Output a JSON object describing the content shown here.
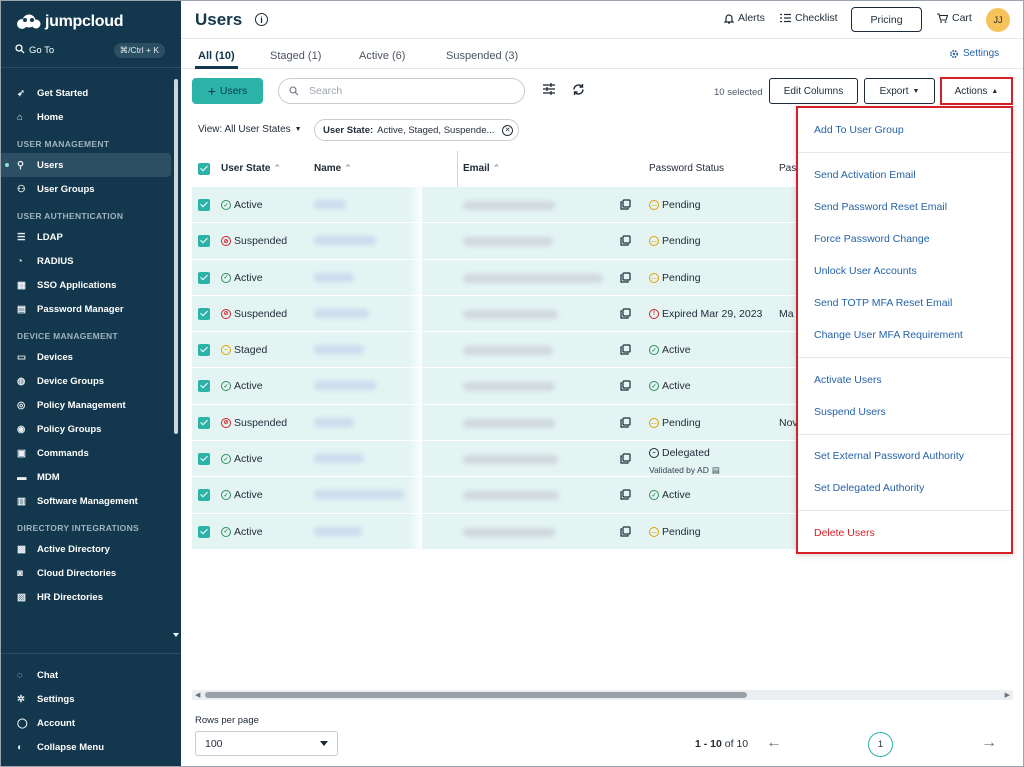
{
  "brand": {
    "name": "jumpcloud"
  },
  "sidebar": {
    "goto": {
      "label": "Go To",
      "shortcut": "⌘/Ctrl + K"
    },
    "items": [
      {
        "type": "item",
        "label": "Get Started",
        "icon": "rocket-icon"
      },
      {
        "type": "item",
        "label": "Home",
        "icon": "home-icon"
      },
      {
        "type": "section",
        "label": "USER MANAGEMENT"
      },
      {
        "type": "item",
        "label": "Users",
        "icon": "user-icon",
        "active": true
      },
      {
        "type": "item",
        "label": "User Groups",
        "icon": "users-icon"
      },
      {
        "type": "section",
        "label": "USER AUTHENTICATION"
      },
      {
        "type": "item",
        "label": "LDAP",
        "icon": "database-icon"
      },
      {
        "type": "item",
        "label": "RADIUS",
        "icon": "radius-icon"
      },
      {
        "type": "item",
        "label": "SSO Applications",
        "icon": "grid-icon"
      },
      {
        "type": "item",
        "label": "Password Manager",
        "icon": "password-icon"
      },
      {
        "type": "section",
        "label": "DEVICE MANAGEMENT"
      },
      {
        "type": "item",
        "label": "Devices",
        "icon": "devices-icon"
      },
      {
        "type": "item",
        "label": "Device Groups",
        "icon": "device-groups-icon"
      },
      {
        "type": "item",
        "label": "Policy Management",
        "icon": "policy-icon"
      },
      {
        "type": "item",
        "label": "Policy Groups",
        "icon": "policy-groups-icon"
      },
      {
        "type": "item",
        "label": "Commands",
        "icon": "terminal-icon"
      },
      {
        "type": "item",
        "label": "MDM",
        "icon": "laptop-icon"
      },
      {
        "type": "item",
        "label": "Software Management",
        "icon": "software-icon"
      },
      {
        "type": "section",
        "label": "DIRECTORY INTEGRATIONS"
      },
      {
        "type": "item",
        "label": "Active Directory",
        "icon": "active-directory-icon"
      },
      {
        "type": "item",
        "label": "Cloud Directories",
        "icon": "cloud-directory-icon"
      },
      {
        "type": "item",
        "label": "HR Directories",
        "icon": "hr-directory-icon"
      }
    ],
    "bottom": [
      {
        "label": "Chat",
        "icon": "chat-icon"
      },
      {
        "label": "Settings",
        "icon": "gear-icon"
      },
      {
        "label": "Account",
        "icon": "account-icon"
      },
      {
        "label": "Collapse Menu",
        "icon": "collapse-icon"
      }
    ]
  },
  "header": {
    "title": "Users",
    "alerts": "Alerts",
    "checklist": "Checklist",
    "pricing": "Pricing",
    "cart": "Cart",
    "avatar": "JJ"
  },
  "tabs": [
    {
      "label": "All (10)",
      "selected": true
    },
    {
      "label": "Staged (1)"
    },
    {
      "label": "Active (6)"
    },
    {
      "label": "Suspended (3)"
    }
  ],
  "settings_link": "Settings",
  "toolbar": {
    "add_label": "Users",
    "search_placeholder": "Search",
    "selected": "10 selected",
    "edit_columns": "Edit Columns",
    "export": "Export",
    "actions": "Actions"
  },
  "filters": {
    "view": "View: All User States",
    "chip_key": "User State:",
    "chip_value": "Active, Staged, Suspende..."
  },
  "table": {
    "columns": [
      "User State",
      "Name",
      "Email",
      "Password Status",
      "Pas"
    ],
    "rows": [
      {
        "state": "Active",
        "pw": "Pending",
        "extra": ""
      },
      {
        "state": "Suspended",
        "pw": "Pending",
        "extra": ""
      },
      {
        "state": "Active",
        "pw": "Pending",
        "extra": ""
      },
      {
        "state": "Suspended",
        "pw": "Expired Mar 29, 2023",
        "extra": "Ma"
      },
      {
        "state": "Staged",
        "pw": "Active",
        "extra": ""
      },
      {
        "state": "Active",
        "pw": "Active",
        "extra": ""
      },
      {
        "state": "Suspended",
        "pw": "Pending",
        "extra": "Nov"
      },
      {
        "state": "Active",
        "pw": "Delegated",
        "sub": "Validated by AD",
        "extra": ""
      },
      {
        "state": "Active",
        "pw": "Active",
        "extra": ""
      },
      {
        "state": "Active",
        "pw": "Pending",
        "extra": ""
      }
    ]
  },
  "actions_menu": {
    "groups": [
      [
        "Add To User Group"
      ],
      [
        "Send Activation Email",
        "Send Password Reset Email",
        "Force Password Change",
        "Unlock User Accounts",
        "Send TOTP MFA Reset Email",
        "Change User MFA Requirement"
      ],
      [
        "Activate Users",
        "Suspend Users"
      ],
      [
        "Set External Password Authority",
        "Set Delegated Authority"
      ],
      [
        "Delete Users"
      ]
    ]
  },
  "pagination": {
    "rows_per_page_label": "Rows per page",
    "rows_per_page": "100",
    "range": "1 - 10",
    "of": "of 10",
    "page": "1"
  },
  "colors": {
    "sidebar": "#13374c",
    "accent": "#2bb3a8",
    "row": "#e3f4f3",
    "link": "#2563a8",
    "danger": "#d61f26",
    "warning": "#e0a100"
  }
}
